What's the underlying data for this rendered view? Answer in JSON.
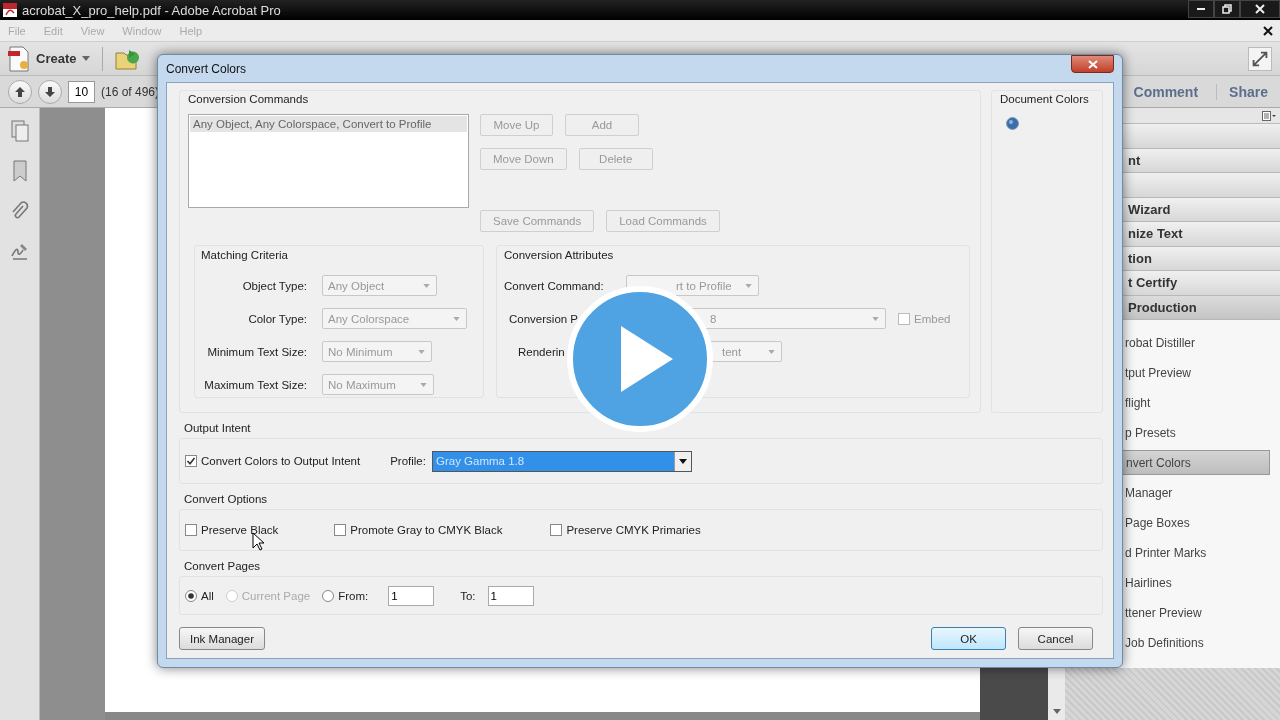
{
  "app": {
    "title": "acrobat_X_pro_help.pdf - Adobe Acrobat Pro",
    "menu": [
      "File",
      "Edit",
      "View",
      "Window",
      "Help"
    ],
    "create_button": "Create",
    "page_number": "10",
    "page_count": "(16 of 496)",
    "task_buttons": [
      "Comment",
      "Share"
    ]
  },
  "tools_panel": {
    "sections": [
      {
        "kind": "header"
      },
      {
        "kind": "header",
        "label": "nt"
      },
      {
        "kind": "header"
      },
      {
        "kind": "header",
        "label": "Wizard"
      },
      {
        "kind": "header",
        "label": "nize Text"
      },
      {
        "kind": "header",
        "label": "tion"
      },
      {
        "kind": "header",
        "label": "t Certify"
      },
      {
        "kind": "open",
        "label": "Production"
      }
    ],
    "items": [
      {
        "label": "robat Distiller",
        "selected": false
      },
      {
        "label": "tput Preview",
        "selected": false
      },
      {
        "label": "flight",
        "selected": false
      },
      {
        "label": "p Presets",
        "selected": false
      },
      {
        "label": "nvert Colors",
        "selected": true
      },
      {
        "label": "Manager",
        "selected": false
      },
      {
        "label": "Page Boxes",
        "selected": false
      },
      {
        "label": "d Printer Marks",
        "selected": false
      },
      {
        "label": "Hairlines",
        "selected": false
      },
      {
        "label": "ttener Preview",
        "selected": false
      },
      {
        "label": "Job Definitions",
        "selected": false
      }
    ]
  },
  "dialog": {
    "title": "Convert Colors",
    "conversion_commands": {
      "heading": "Conversion Commands",
      "list": [
        {
          "text": "Any Object, Any Colorspace, Convert to Profile",
          "selected": true
        }
      ],
      "buttons": [
        {
          "label": "Move Up",
          "disabled": true
        },
        {
          "label": "Add",
          "disabled": true
        },
        {
          "label": "Move Down",
          "disabled": true
        },
        {
          "label": "Delete",
          "disabled": true
        },
        {
          "label": "Save Commands",
          "disabled": true
        },
        {
          "label": "Load Commands",
          "disabled": true
        }
      ]
    },
    "document_colors": {
      "heading": "Document Colors"
    },
    "matching_criteria": {
      "heading": "Matching Criteria",
      "fields": [
        {
          "label": "Object Type:",
          "value": "Any Object",
          "disabled": true
        },
        {
          "label": "Color Type:",
          "value": "Any Colorspace",
          "disabled": true
        },
        {
          "label": "Minimum Text Size:",
          "value": "No Minimum",
          "disabled": true
        },
        {
          "label": "Maximum Text Size:",
          "value": "No Maximum",
          "disabled": true
        }
      ]
    },
    "conversion_attributes": {
      "heading": "Conversion Attributes",
      "fields": [
        {
          "label": "Convert Command:",
          "value": "rt to Profile",
          "disabled": true
        },
        {
          "label": "Conversion P",
          "value": "8",
          "disabled": true
        },
        {
          "label": "Renderin",
          "value": "tent",
          "disabled": true
        }
      ],
      "embed": {
        "label": "Embed",
        "checked": false,
        "disabled": true
      }
    },
    "output_intent": {
      "heading": "Output Intent",
      "checkbox": {
        "label": "Convert Colors to Output Intent",
        "checked": true
      },
      "profile_label": "Profile:",
      "profile_value": "Gray Gamma 1.8"
    },
    "convert_options": {
      "heading": "Convert Options",
      "options": [
        {
          "label": "Preserve Black",
          "checked": false
        },
        {
          "label": "Promote Gray to CMYK Black",
          "checked": false
        },
        {
          "label": "Preserve CMYK Primaries",
          "checked": false
        }
      ]
    },
    "convert_pages": {
      "heading": "Convert Pages",
      "radios": [
        {
          "label": "All",
          "selected": true,
          "disabled": false
        },
        {
          "label": "Current Page",
          "selected": false,
          "disabled": true
        },
        {
          "label": "From:",
          "selected": false,
          "disabled": false
        }
      ],
      "from": "1",
      "to_label": "To:",
      "to": "1"
    },
    "buttons": {
      "ink_manager": "Ink Manager",
      "ok": "OK",
      "cancel": "Cancel"
    }
  }
}
